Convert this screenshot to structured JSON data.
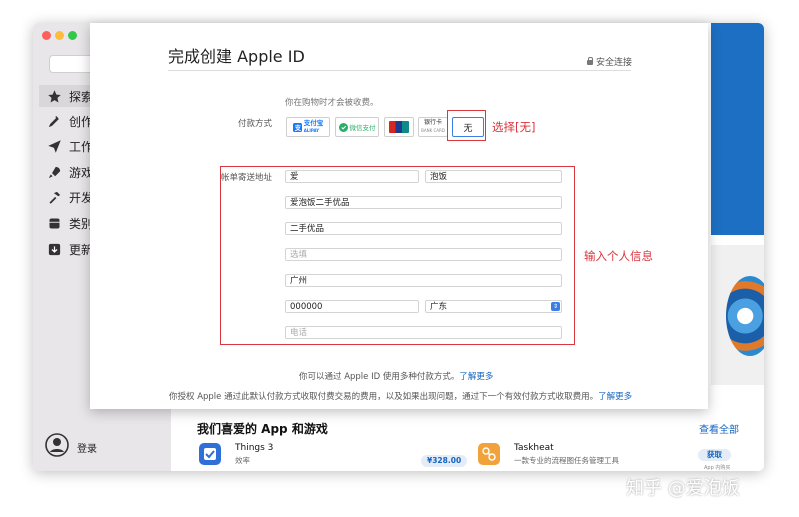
{
  "sidebar": {
    "search_placeholder": "Q",
    "items": [
      {
        "label": "探索",
        "icon": "star-icon",
        "active": true
      },
      {
        "label": "创作",
        "icon": "brush-icon"
      },
      {
        "label": "工作",
        "icon": "paper-plane-icon"
      },
      {
        "label": "游戏",
        "icon": "rocket-icon"
      },
      {
        "label": "开发",
        "icon": "hammer-icon"
      },
      {
        "label": "类别",
        "icon": "category-icon"
      },
      {
        "label": "更新",
        "icon": "download-icon"
      }
    ],
    "login": "登录"
  },
  "store": {
    "favorites_title": "我们喜爱的 App 和游戏",
    "see_all": "查看全部",
    "apps": [
      {
        "name": "Things 3",
        "subtitle": "效率",
        "price": "¥328.00"
      },
      {
        "name": "Taskheat",
        "subtitle": "一款专业的流程图任务管理工具",
        "action": "获取",
        "note": "App 内购买"
      }
    ]
  },
  "sheet": {
    "title": "完成创建 Apple ID",
    "secure_label": "安全连接",
    "hint": "你在购物时才会被收费。",
    "payment_label": "付款方式",
    "payment_options": {
      "alipay": "支付宝",
      "alipay_sub": "ALIPAY",
      "wechat": "微信支付",
      "bank": "银行卡",
      "bank_sub": "BANK CARD",
      "none": "无"
    },
    "address_label": "帐单寄送地址",
    "address": {
      "first_name": "爱",
      "last_name": "泡饭",
      "line1": "爱泡饭二手优品",
      "line2": "二手优品",
      "line3_placeholder": "选填",
      "city": "广州",
      "postcode": "000000",
      "province": "广东",
      "phone_placeholder": "电话"
    },
    "info1": "你可以通过 Apple ID 使用多种付款方式。",
    "info1_link": "了解更多",
    "info2": "你授权 Apple 通过此默认付款方式收取付费交易的费用，以及如果出现问题，通过下一个有效付款方式收取费用。",
    "info2_link": "了解更多"
  },
  "annotations": {
    "select_none": "选择[无]",
    "enter_info": "输入个人信息"
  },
  "watermark": "知乎 @爱泡饭",
  "colors": {
    "accent": "#3a7ee6",
    "annotation": "#d9363e",
    "link": "#1565c0"
  }
}
